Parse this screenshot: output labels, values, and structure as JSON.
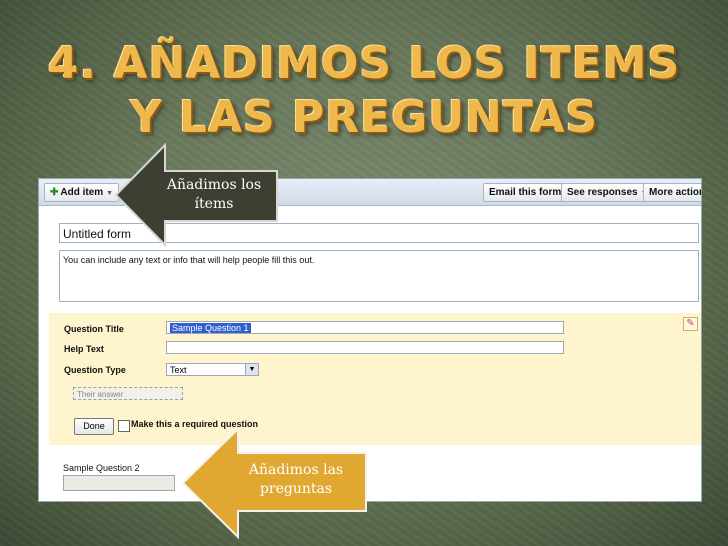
{
  "slide": {
    "title_line1": "4. AÑADIMOS LOS ITEMS",
    "title_line2": "Y LAS PREGUNTAS",
    "title_color": "#efb84c"
  },
  "toolbar": {
    "add_item": "Add item",
    "email_form": "Email this form",
    "see_responses": "See responses",
    "more_actions": "More actions"
  },
  "form": {
    "title": "Untitled form",
    "description": "You can include any text or info that will help people fill this out."
  },
  "question_editor": {
    "title_label": "Question Title",
    "title_value": "Sample Question 1",
    "help_label": "Help Text",
    "help_value": "",
    "type_label": "Question Type",
    "type_value": "Text",
    "answer_placeholder": "Their answer",
    "done_label": "Done",
    "required_label": "Make this a required question",
    "required_checked": false
  },
  "question2": {
    "title": "Sample Question 2"
  },
  "callouts": {
    "items_line1": "Añadimos los",
    "items_line2": "ítems",
    "questions_line1": "Añadimos las",
    "questions_line2": "preguntas",
    "items_color": "#3d3f33",
    "questions_color": "#e0a830"
  }
}
